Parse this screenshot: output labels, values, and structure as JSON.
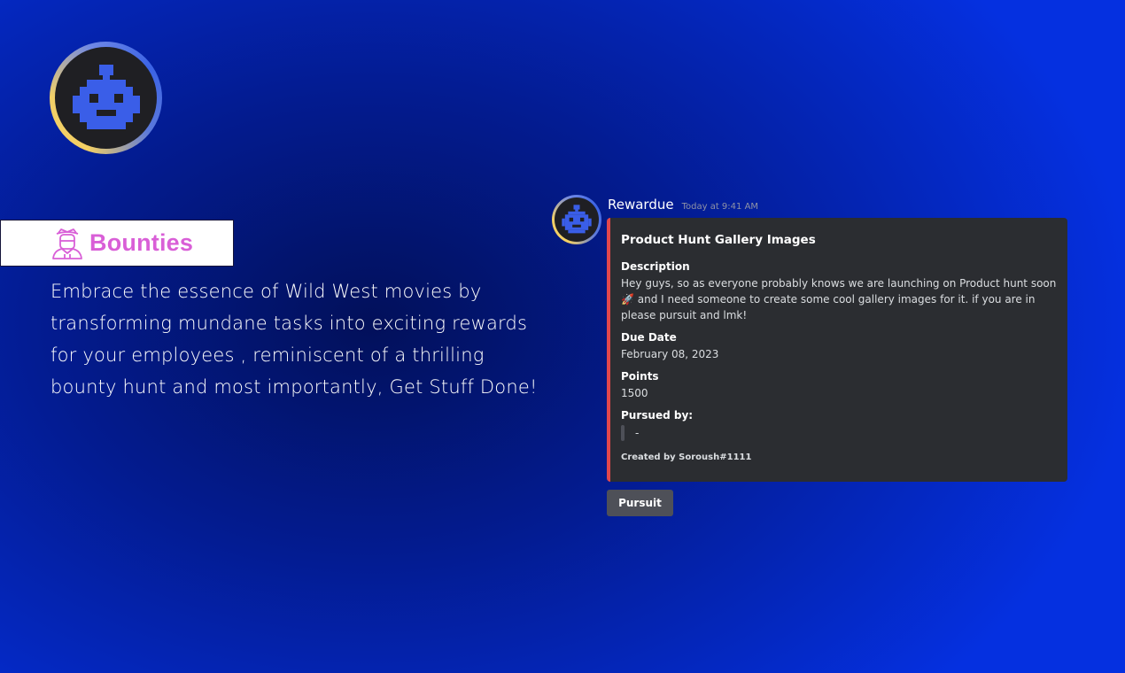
{
  "hero": {
    "tag_label": "Bounties",
    "description": "Embrace the essence of Wild West movies by transforming mundane tasks into exciting rewards for your employees , reminiscent of a thrilling bounty hunt and most importantly, Get Stuff Done!"
  },
  "message": {
    "author": "Rewardue",
    "timestamp": "Today at 9:41 AM",
    "embed": {
      "title": "Product Hunt Gallery Images",
      "description_label": "Description",
      "description_text": "Hey guys, so as everyone probably knows we are launching on Product hunt soon 🚀 and I need someone to create some cool gallery images for it. if you are in please pursuit and lmk!",
      "due_date_label": "Due Date",
      "due_date": "February 08, 2023",
      "points_label": "Points",
      "points": "1500",
      "pursued_by_label": "Pursued by:",
      "pursued_by": "-",
      "footer": "Created by Soroush#1111",
      "accent_color": "#e0474c"
    },
    "button_label": "Pursuit"
  },
  "colors": {
    "brand_pink": "#d95fd7",
    "robot_blue": "#3a5ee8",
    "embed_bg": "#2b2d31"
  }
}
